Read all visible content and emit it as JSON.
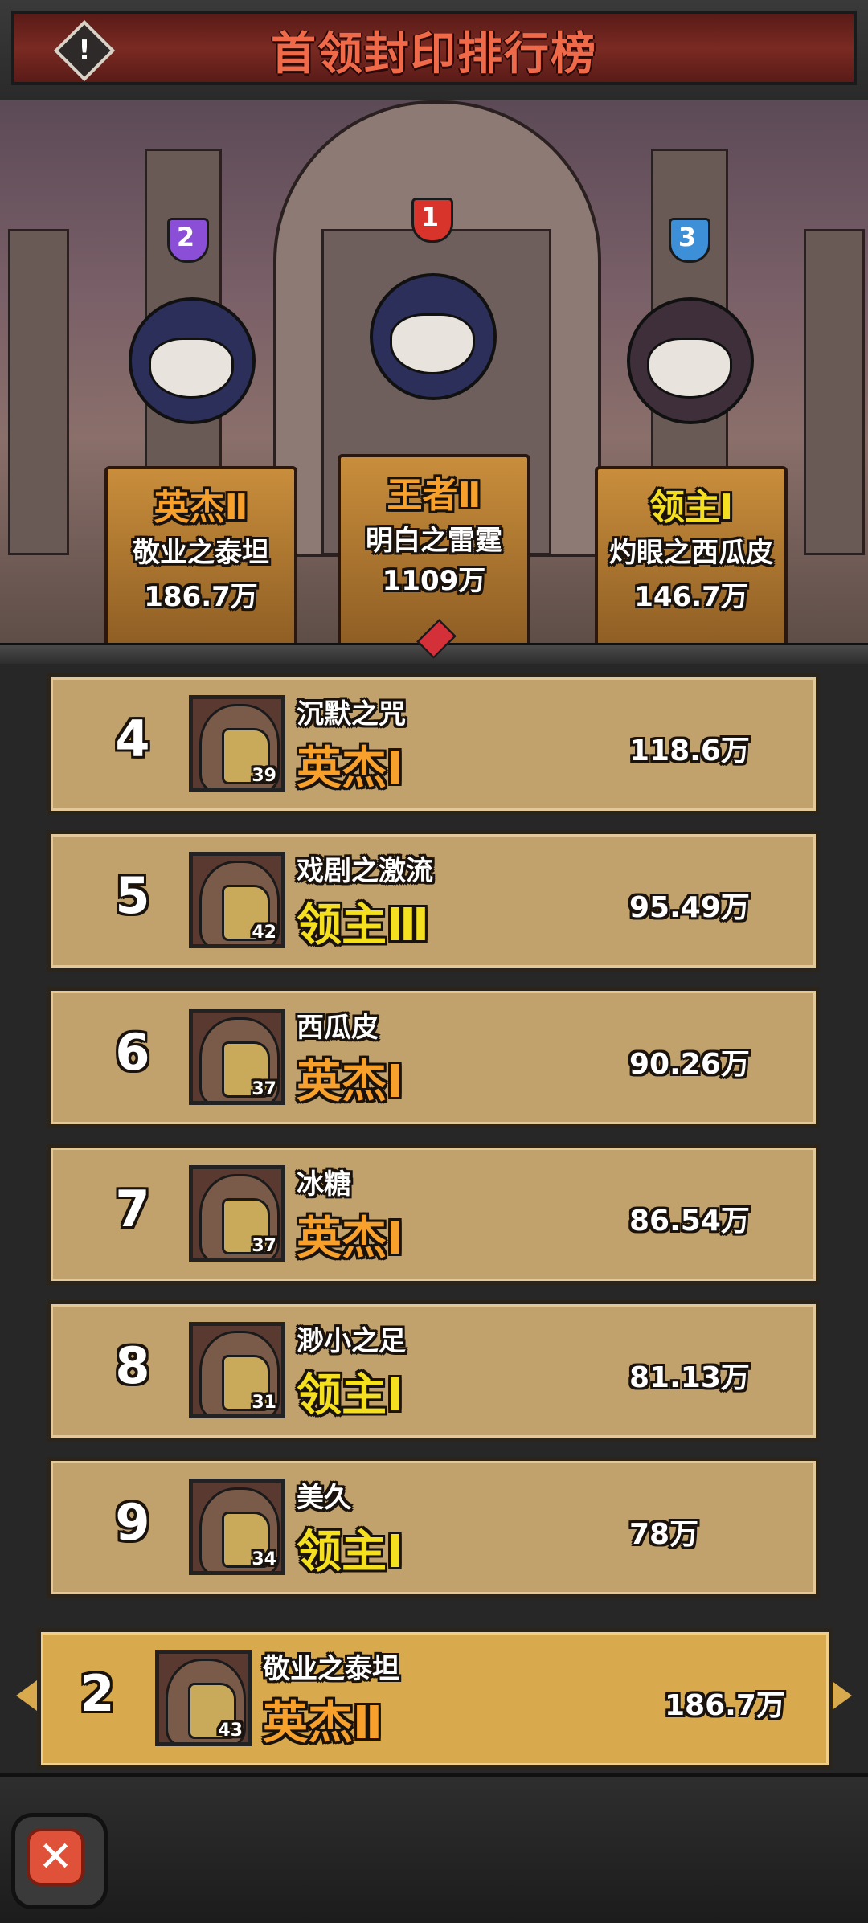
{
  "header": {
    "title": "首领封印排行榜",
    "alert_icon": "!"
  },
  "podium": [
    {
      "rank": "2",
      "tier": "英杰Ⅱ",
      "tier_color": "#f7a12c",
      "name": "敬业之泰坦",
      "score": "186.7万",
      "badge_color": "#8a4fd6"
    },
    {
      "rank": "1",
      "tier": "王者Ⅱ",
      "tier_color": "#f7a12c",
      "name": "明白之雷霆",
      "score": "1109万",
      "badge_color": "#d8342c"
    },
    {
      "rank": "3",
      "tier": "领主Ⅰ",
      "tier_color": "#f5e020",
      "name": "灼眼之西瓜皮",
      "score": "146.7万",
      "badge_color": "#3d8fd8"
    }
  ],
  "ranking": [
    {
      "rank": "4",
      "name": "沉默之咒",
      "level": "39",
      "tier": "英杰Ⅰ",
      "tier_type": "hero",
      "score": "118.6万"
    },
    {
      "rank": "5",
      "name": "戏剧之激流",
      "level": "42",
      "tier": "领主Ⅲ",
      "tier_type": "lord",
      "score": "95.49万"
    },
    {
      "rank": "6",
      "name": "西瓜皮",
      "level": "37",
      "tier": "英杰Ⅰ",
      "tier_type": "hero",
      "score": "90.26万"
    },
    {
      "rank": "7",
      "name": "冰糖",
      "level": "37",
      "tier": "英杰Ⅰ",
      "tier_type": "hero",
      "score": "86.54万"
    },
    {
      "rank": "8",
      "name": "渺小之足",
      "level": "31",
      "tier": "领主Ⅰ",
      "tier_type": "lord",
      "score": "81.13万"
    },
    {
      "rank": "9",
      "name": "美久",
      "level": "34",
      "tier": "领主Ⅰ",
      "tier_type": "lord",
      "score": "78万"
    }
  ],
  "my_rank": {
    "rank": "2",
    "name": "敬业之泰坦",
    "level": "43",
    "tier": "英杰Ⅱ",
    "score": "186.7万"
  },
  "footer": {
    "close_icon": "✕"
  }
}
